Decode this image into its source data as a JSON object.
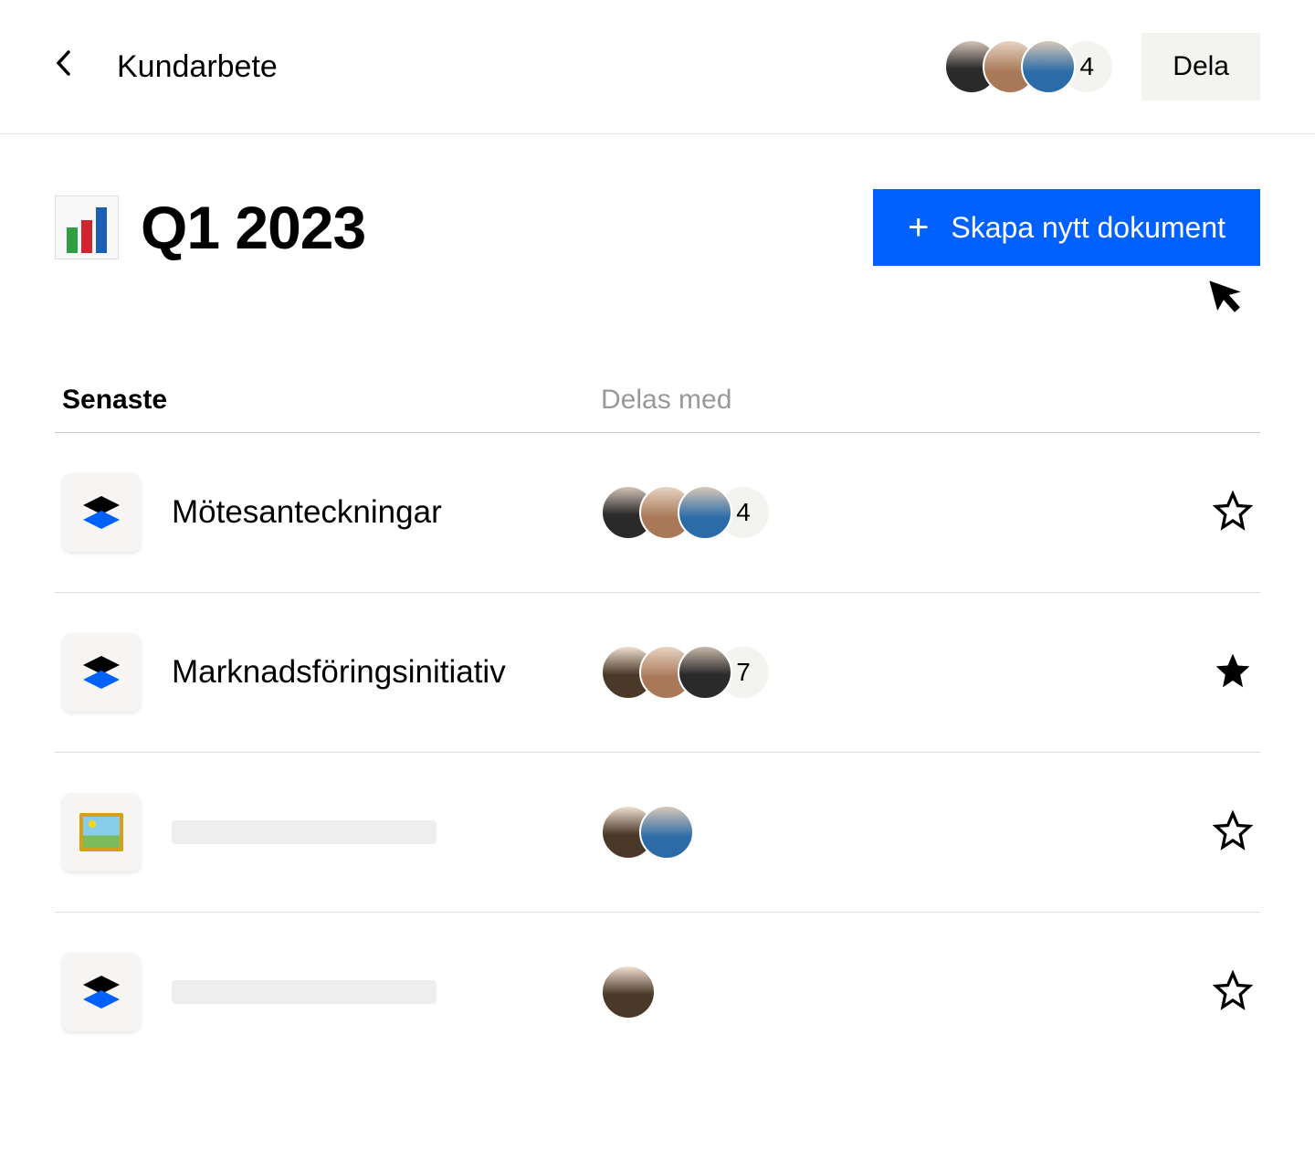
{
  "header": {
    "breadcrumb": "Kundarbete",
    "share_label": "Dela",
    "overflow_count": "4"
  },
  "page": {
    "title": "Q1 2023",
    "create_label": "Skapa nytt dokument"
  },
  "columns": {
    "recent": "Senaste",
    "shared": "Delas med"
  },
  "rows": [
    {
      "name": "Mötesanteckningar",
      "icon": "dropbox",
      "overflow": "4",
      "starred": false,
      "avatars": 3
    },
    {
      "name": "Marknadsföringsinitiativ",
      "icon": "dropbox",
      "overflow": "7",
      "starred": true,
      "avatars": 3
    },
    {
      "name": "",
      "icon": "picture",
      "overflow": "",
      "starred": false,
      "avatars": 2
    },
    {
      "name": "",
      "icon": "dropbox",
      "overflow": "",
      "starred": false,
      "avatars": 1
    }
  ]
}
